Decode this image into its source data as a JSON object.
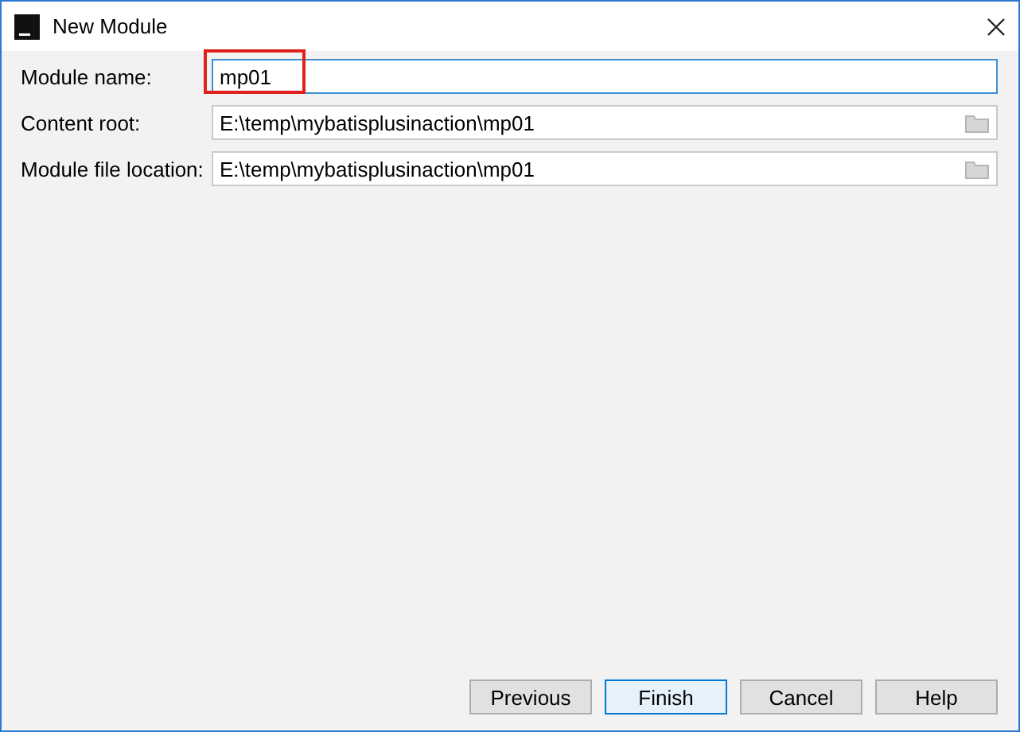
{
  "window": {
    "title": "New Module"
  },
  "fields": [
    {
      "label": "Module name:",
      "value": "mp01",
      "focused": true,
      "browse": false,
      "highlighted": true
    },
    {
      "label": "Content root:",
      "value": "E:\\temp\\mybatisplusinaction\\mp01",
      "focused": false,
      "browse": true,
      "highlighted": false
    },
    {
      "label": "Module file location:",
      "value": "E:\\temp\\mybatisplusinaction\\mp01",
      "focused": false,
      "browse": true,
      "highlighted": false
    }
  ],
  "buttons": [
    {
      "label": "Previous",
      "default": false
    },
    {
      "label": "Finish",
      "default": true
    },
    {
      "label": "Cancel",
      "default": false
    },
    {
      "label": "Help",
      "default": false
    }
  ]
}
